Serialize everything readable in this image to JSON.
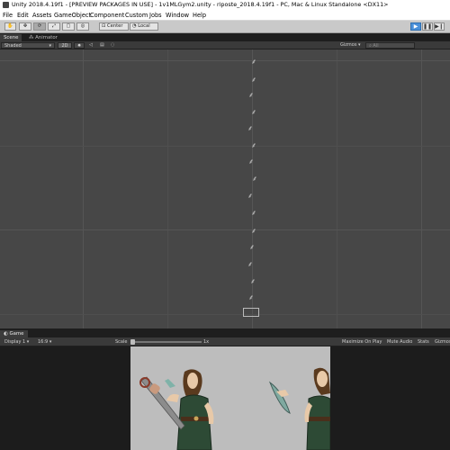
{
  "window": {
    "title": "Unity 2018.4.19f1 - [PREVIEW PACKAGES IN USE] - 1v1MLGym2.unity - riposte_2018.4.19f1 - PC, Mac & Linux Standalone <DX11>"
  },
  "menu": {
    "items": [
      "File",
      "Edit",
      "Assets",
      "GameObject",
      "Component",
      "Custom",
      "Jobs",
      "Window",
      "Help"
    ]
  },
  "toolbar": {
    "pivot_label": "Center",
    "space_label": "Local",
    "tools": [
      "hand-tool",
      "move-tool",
      "rotate-tool",
      "scale-tool",
      "rect-tool",
      "transform-tool"
    ],
    "play_active": true
  },
  "tabs": {
    "scene": "Scene",
    "animator": "Animator"
  },
  "scene_toolbar": {
    "draw_mode": "Shaded",
    "mode_2d": "2D",
    "gizmos": "Gizmos",
    "search_placeholder": "All"
  },
  "game": {
    "tab": "Game",
    "display": "Display 1",
    "aspect": "16:9",
    "scale_label": "Scale",
    "scale_value": "1x",
    "maximize": "Maximize On Play",
    "mute": "Mute Audio",
    "stats": "Stats",
    "gizmos": "Gizmos"
  },
  "colors": {
    "scene_bg": "#474747",
    "play_accent": "#4a90d9",
    "game_bg": "#bdbdbd",
    "armor_green": "#2d4a35"
  }
}
